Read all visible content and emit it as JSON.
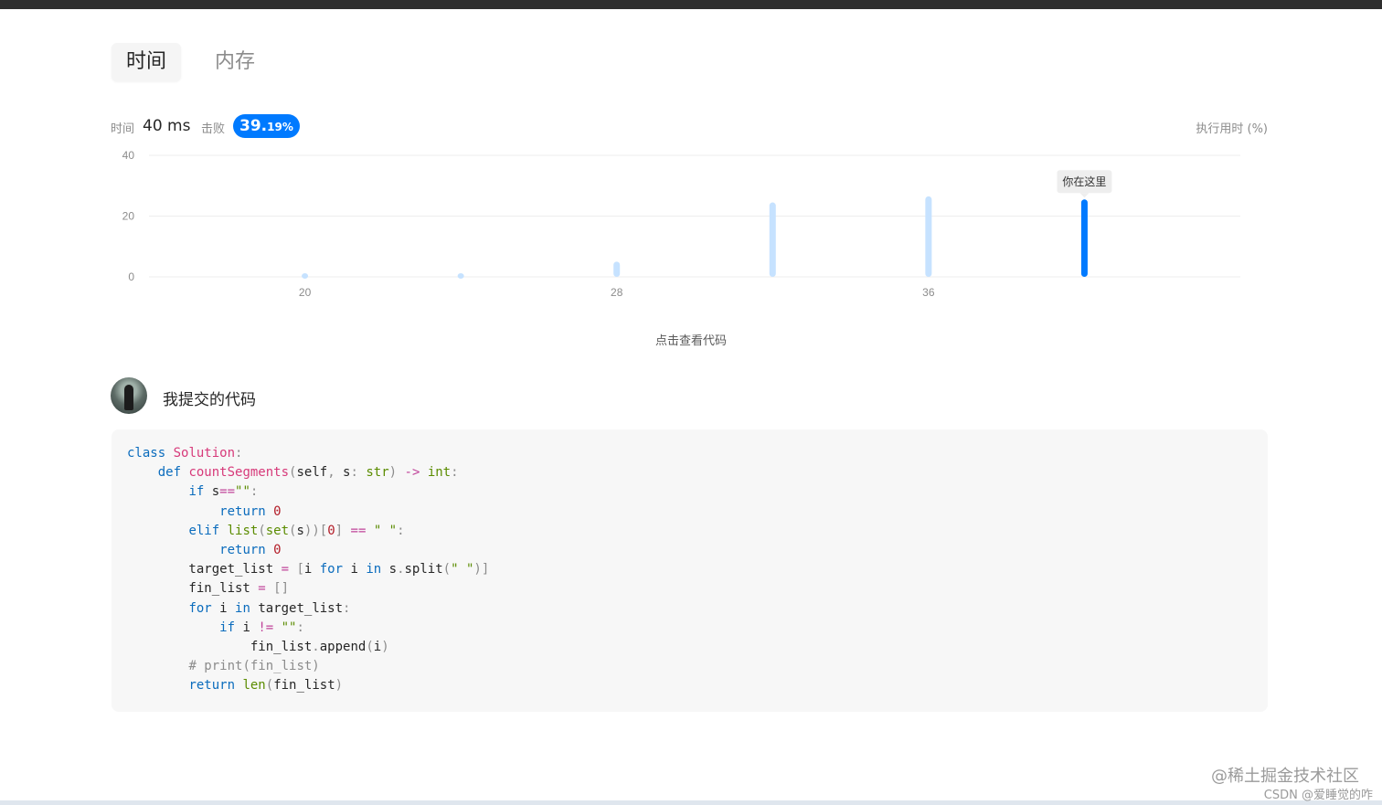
{
  "tabs": {
    "time": "时间",
    "memory": "内存"
  },
  "stats": {
    "time_label": "时间",
    "time_value": "40 ms",
    "beats_label": "击败",
    "beats_main": "39.",
    "beats_decimal": "19%"
  },
  "chart_data": {
    "type": "bar",
    "legend_label": "执行用时 (%)",
    "x": [
      20,
      24,
      28,
      32,
      36,
      40
    ],
    "values": [
      1.2,
      1.2,
      5,
      24.5,
      26.5,
      25.5
    ],
    "highlight_index": 5,
    "tooltip": "你在这里",
    "ylim": [
      0,
      40
    ],
    "yticks": [
      "0",
      "20",
      "40"
    ],
    "xticks": [
      {
        "value": 20,
        "label": "20"
      },
      {
        "value": 28,
        "label": "28"
      },
      {
        "value": 36,
        "label": "36"
      }
    ],
    "xlim": [
      16,
      44
    ],
    "colors": {
      "bar": "#c6e2ff",
      "highlight": "#007aff",
      "grid": "#eeeeee",
      "tick": "#8c8c8c"
    }
  },
  "view_code_label": "点击查看代码",
  "submission": {
    "title": "我提交的代码",
    "code_lines": [
      [
        [
          "kw",
          "class"
        ],
        [
          "t",
          " "
        ],
        [
          "fn",
          "Solution"
        ],
        [
          "pn",
          ":"
        ]
      ],
      [
        [
          "t",
          "    "
        ],
        [
          "kw",
          "def"
        ],
        [
          "t",
          " "
        ],
        [
          "fn",
          "countSegments"
        ],
        [
          "pn",
          "("
        ],
        [
          "t",
          "self"
        ],
        [
          "pn",
          ","
        ],
        [
          "t",
          " s"
        ],
        [
          "pn",
          ":"
        ],
        [
          "t",
          " "
        ],
        [
          "bi",
          "str"
        ],
        [
          "pn",
          ")"
        ],
        [
          "t",
          " "
        ],
        [
          "op",
          "->"
        ],
        [
          "t",
          " "
        ],
        [
          "bi",
          "int"
        ],
        [
          "pn",
          ":"
        ]
      ],
      [
        [
          "t",
          "        "
        ],
        [
          "kw",
          "if"
        ],
        [
          "t",
          " s"
        ],
        [
          "op",
          "=="
        ],
        [
          "str",
          "\"\""
        ],
        [
          "pn",
          ":"
        ]
      ],
      [
        [
          "t",
          "            "
        ],
        [
          "kw",
          "return"
        ],
        [
          "t",
          " "
        ],
        [
          "num",
          "0"
        ]
      ],
      [
        [
          "t",
          "        "
        ],
        [
          "kw",
          "elif"
        ],
        [
          "t",
          " "
        ],
        [
          "bi",
          "list"
        ],
        [
          "pn",
          "("
        ],
        [
          "bi",
          "set"
        ],
        [
          "pn",
          "("
        ],
        [
          "t",
          "s"
        ],
        [
          "pn",
          "))"
        ],
        [
          "pn",
          "["
        ],
        [
          "num",
          "0"
        ],
        [
          "pn",
          "]"
        ],
        [
          "t",
          " "
        ],
        [
          "op",
          "=="
        ],
        [
          "t",
          " "
        ],
        [
          "str",
          "\" \""
        ],
        [
          "pn",
          ":"
        ]
      ],
      [
        [
          "t",
          "            "
        ],
        [
          "kw",
          "return"
        ],
        [
          "t",
          " "
        ],
        [
          "num",
          "0"
        ]
      ],
      [
        [
          "t",
          "        target_list "
        ],
        [
          "op",
          "="
        ],
        [
          "t",
          " "
        ],
        [
          "pn",
          "["
        ],
        [
          "t",
          "i "
        ],
        [
          "kw",
          "for"
        ],
        [
          "t",
          " i "
        ],
        [
          "kw",
          "in"
        ],
        [
          "t",
          " s"
        ],
        [
          "pn",
          "."
        ],
        [
          "t",
          "split"
        ],
        [
          "pn",
          "("
        ],
        [
          "str",
          "\" \""
        ],
        [
          "pn",
          ")]"
        ]
      ],
      [
        [
          "t",
          "        fin_list "
        ],
        [
          "op",
          "="
        ],
        [
          "t",
          " "
        ],
        [
          "pn",
          "[]"
        ]
      ],
      [
        [
          "t",
          "        "
        ],
        [
          "kw",
          "for"
        ],
        [
          "t",
          " i "
        ],
        [
          "kw",
          "in"
        ],
        [
          "t",
          " target_list"
        ],
        [
          "pn",
          ":"
        ]
      ],
      [
        [
          "t",
          "            "
        ],
        [
          "kw",
          "if"
        ],
        [
          "t",
          " i "
        ],
        [
          "op",
          "!="
        ],
        [
          "t",
          " "
        ],
        [
          "str",
          "\"\""
        ],
        [
          "pn",
          ":"
        ]
      ],
      [
        [
          "t",
          "                fin_list"
        ],
        [
          "pn",
          "."
        ],
        [
          "t",
          "append"
        ],
        [
          "pn",
          "("
        ],
        [
          "t",
          "i"
        ],
        [
          "pn",
          ")"
        ]
      ],
      [
        [
          "t",
          "        "
        ],
        [
          "cm",
          "# print(fin_list)"
        ]
      ],
      [
        [
          "t",
          "        "
        ],
        [
          "kw",
          "return"
        ],
        [
          "t",
          " "
        ],
        [
          "bi",
          "len"
        ],
        [
          "pn",
          "("
        ],
        [
          "t",
          "fin_list"
        ],
        [
          "pn",
          ")"
        ]
      ]
    ]
  },
  "watermark": "@稀土掘金技术社区",
  "csdn_mark": "CSDN @爱睡觉的咋"
}
